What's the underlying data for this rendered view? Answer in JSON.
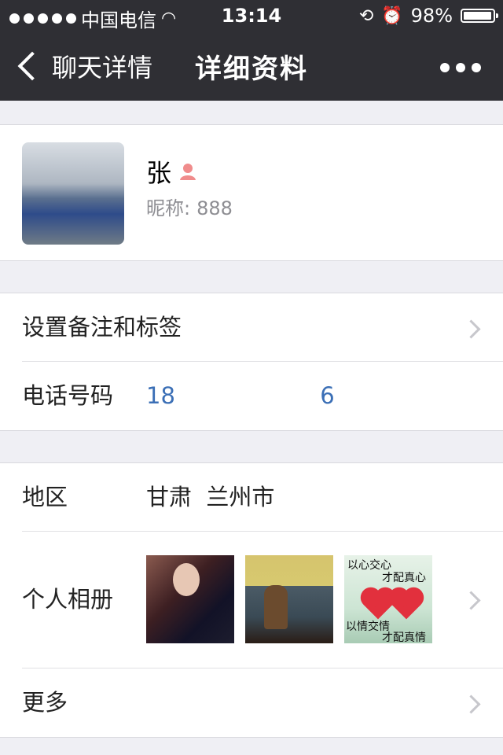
{
  "status_bar": {
    "carrier": "中国电信",
    "time": "13:14",
    "battery": "98%",
    "battery_level": 0.98
  },
  "nav": {
    "back_label": "聊天详情",
    "title": "详细资料"
  },
  "profile": {
    "name": "张",
    "nickname_label": "昵称:",
    "nickname": "888",
    "gender_icon": "female-icon"
  },
  "rows": {
    "remark": "设置备注和标签",
    "phone_label": "电话号码",
    "phone_value": "18                    6",
    "region_label": "地区",
    "region_value": "甘肃  兰州市",
    "album_label": "个人相册",
    "more_label": "更多"
  },
  "album_photo3": {
    "line1": "以心交心",
    "line2": "才配真心",
    "line3": "以情交情",
    "line4": "才配真情"
  }
}
